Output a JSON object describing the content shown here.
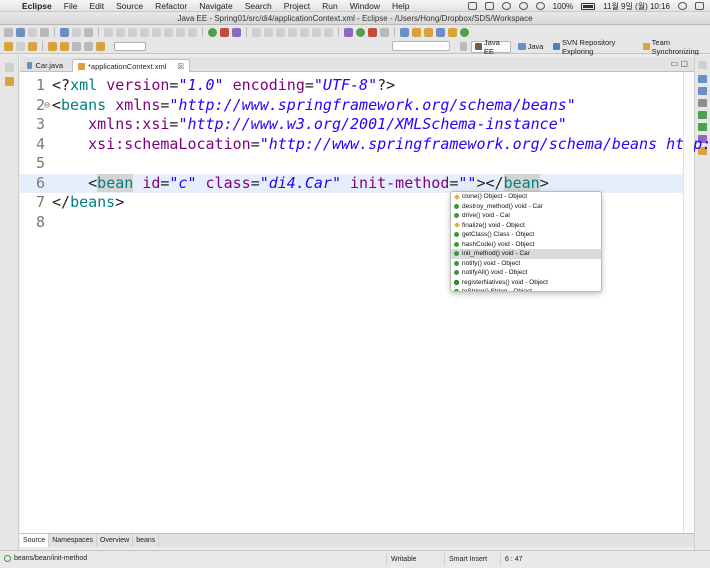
{
  "menubar": {
    "app": "Eclipse",
    "items": [
      "File",
      "Edit",
      "Source",
      "Refactor",
      "Navigate",
      "Search",
      "Project",
      "Run",
      "Window",
      "Help"
    ],
    "battery": "100%",
    "clock": "11월 9일 (월)  10:16"
  },
  "window": {
    "title": "Java EE - Spring01/src/di4/applicationContext.xml - Eclipse - /Users/Hong/Dropbox/SDS/Workspace"
  },
  "perspectives": [
    {
      "label": "Java EE",
      "active": true,
      "color": "#7a5a3a"
    },
    {
      "label": "Java",
      "active": false,
      "color": "#6b8fc5"
    },
    {
      "label": "SVN Repository Exploring",
      "active": false,
      "color": "#4e7fb5"
    },
    {
      "label": "Team Synchronizing",
      "active": false,
      "color": "#d9a23a"
    }
  ],
  "tabs": [
    {
      "label": "Car.java",
      "icon": "java-file-icon"
    },
    {
      "label": "*applicationContext.xml",
      "icon": "xml-file-icon",
      "close": "☒"
    }
  ],
  "editor": {
    "lines": [
      {
        "no": "1",
        "segments": [
          [
            "pl",
            "<?"
          ],
          [
            "kw",
            "xml"
          ],
          [
            "pl",
            " "
          ],
          [
            "at",
            "version"
          ],
          [
            "pl",
            "="
          ],
          [
            "st",
            "\"1.0\""
          ],
          [
            "pl",
            " "
          ],
          [
            "at",
            "encoding"
          ],
          [
            "pl",
            "="
          ],
          [
            "st",
            "\"UTF-8\""
          ],
          [
            "pl",
            "?>"
          ]
        ]
      },
      {
        "no": "2",
        "fold": "⊖",
        "segments": [
          [
            "pl",
            "<"
          ],
          [
            "kw",
            "beans"
          ],
          [
            "pl",
            " "
          ],
          [
            "at",
            "xmlns"
          ],
          [
            "pl",
            "="
          ],
          [
            "st",
            "\"http://www.springframework.org/schema/beans\""
          ]
        ]
      },
      {
        "no": "3",
        "segments": [
          [
            "pl",
            "    "
          ],
          [
            "at",
            "xmlns:xsi"
          ],
          [
            "pl",
            "="
          ],
          [
            "st",
            "\"http://www.w3.org/2001/XMLSchema-instance\""
          ]
        ]
      },
      {
        "no": "4",
        "segments": [
          [
            "pl",
            "    "
          ],
          [
            "at",
            "xsi:schemaLocation"
          ],
          [
            "pl",
            "="
          ],
          [
            "st",
            "\"http://www.springframework.org/schema/beans http:"
          ]
        ]
      },
      {
        "no": "5",
        "segments": []
      },
      {
        "no": "6",
        "current": true,
        "segments": [
          [
            "pl",
            "    <"
          ],
          [
            "kwhl",
            "bean"
          ],
          [
            "pl",
            " "
          ],
          [
            "at",
            "id"
          ],
          [
            "pl",
            "="
          ],
          [
            "st",
            "\"c\""
          ],
          [
            "pl",
            " "
          ],
          [
            "at",
            "class"
          ],
          [
            "pl",
            "="
          ],
          [
            "st",
            "\"di4.Car\""
          ],
          [
            "pl",
            " "
          ],
          [
            "at",
            "init-method"
          ],
          [
            "pl",
            "="
          ],
          [
            "st",
            "\"\""
          ],
          [
            "pl",
            "></"
          ],
          [
            "kwhl",
            "bean"
          ],
          [
            "pl",
            ">"
          ]
        ]
      },
      {
        "no": "7",
        "segments": [
          [
            "pl",
            "</"
          ],
          [
            "kw",
            "beans"
          ],
          [
            "pl",
            ">"
          ]
        ]
      },
      {
        "no": "8",
        "segments": []
      }
    ]
  },
  "content_assist": {
    "items": [
      {
        "label": "clone() Object - Object",
        "icon": "protected-method-icon",
        "selected": false
      },
      {
        "label": "destroy_method()  void - Car",
        "icon": "public-method-icon",
        "selected": false
      },
      {
        "label": "drive()  void - Car",
        "icon": "public-method-icon",
        "selected": false
      },
      {
        "label": "finalize()  void - Object",
        "icon": "protected-method-icon",
        "selected": false
      },
      {
        "label": "getClass() Class - Object",
        "icon": "final-method-icon",
        "selected": false
      },
      {
        "label": "hashCode()  void - Object",
        "icon": "native-method-icon",
        "selected": false
      },
      {
        "label": "init_method()  void - Car",
        "icon": "public-method-icon",
        "selected": true
      },
      {
        "label": "notify()  void - Object",
        "icon": "final-method-icon",
        "selected": false
      },
      {
        "label": "notifyAll()  void - Object",
        "icon": "final-method-icon",
        "selected": false
      },
      {
        "label": "registerNatives()  void - Object",
        "icon": "private-static-method-icon",
        "selected": false
      },
      {
        "label": "toString() String - Object",
        "icon": "public-method-icon",
        "selected": false
      }
    ]
  },
  "bottom_tabs": [
    "Source",
    "Namespaces",
    "Overview",
    "beans"
  ],
  "status": {
    "path": "beans/bean/init-method",
    "mode": "Writable",
    "insert": "Smart Insert",
    "position": "6 : 47"
  }
}
